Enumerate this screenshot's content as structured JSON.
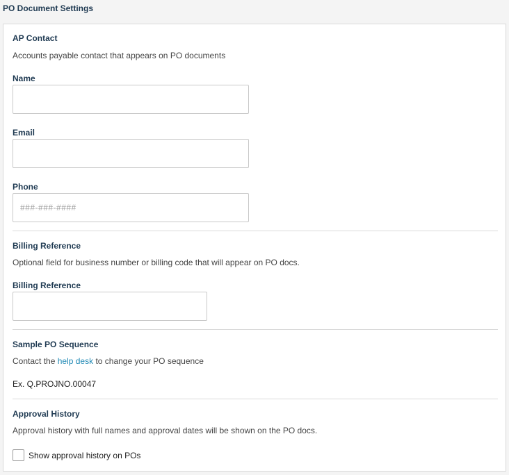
{
  "page_title": "PO Document Settings",
  "ap_contact": {
    "title": "AP Contact",
    "description": "Accounts payable contact that appears on PO documents",
    "name_label": "Name",
    "name_value": "",
    "email_label": "Email",
    "email_value": "",
    "phone_label": "Phone",
    "phone_placeholder": "###-###-####"
  },
  "billing": {
    "title": "Billing Reference",
    "description": "Optional field for business number or billing code that will appear on PO docs.",
    "field_label": "Billing Reference",
    "field_value": ""
  },
  "sequence": {
    "title": "Sample PO Sequence",
    "desc_prefix": "Contact the",
    "link_text": "help desk",
    "desc_suffix": "to change your PO sequence",
    "example": "Ex. Q.PROJNO.00047"
  },
  "approval": {
    "title": "Approval History",
    "description": "Approval history with full names and approval dates will be shown on the PO docs.",
    "checkbox_label": "Show approval history on POs",
    "checked": false
  },
  "colors": {
    "heading": "#1f3a52",
    "link": "#1e88b4",
    "border": "#d9d9d9"
  }
}
